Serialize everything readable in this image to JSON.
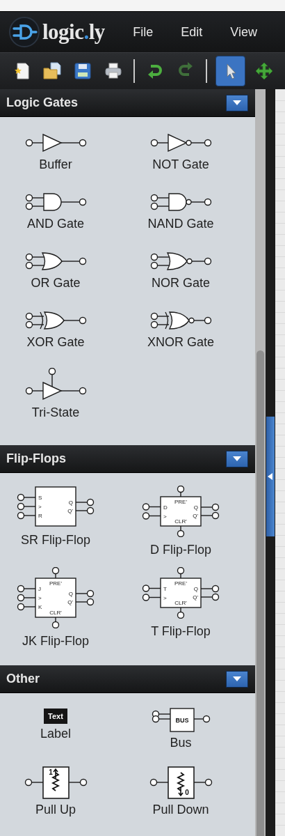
{
  "logo_parts": [
    {
      "text": "logic",
      "accent": false
    },
    {
      "text": ".",
      "accent": true
    },
    {
      "text": "ly",
      "accent": false
    }
  ],
  "menu": [
    "File",
    "Edit",
    "View"
  ],
  "toolbar": [
    {
      "kind": "new",
      "selected": false
    },
    {
      "kind": "open",
      "selected": false
    },
    {
      "kind": "save",
      "selected": false
    },
    {
      "kind": "print",
      "selected": false
    },
    {
      "kind": "separator"
    },
    {
      "kind": "undo",
      "selected": false,
      "disabled": false
    },
    {
      "kind": "redo",
      "selected": false,
      "disabled": true
    },
    {
      "kind": "separator"
    },
    {
      "kind": "select",
      "selected": true
    },
    {
      "kind": "pan",
      "selected": false
    }
  ],
  "sections": [
    {
      "title": "Logic Gates",
      "items": [
        {
          "kind": "buffer",
          "label": "Buffer"
        },
        {
          "kind": "not",
          "label": "NOT Gate"
        },
        {
          "kind": "and",
          "label": "AND Gate"
        },
        {
          "kind": "nand",
          "label": "NAND Gate"
        },
        {
          "kind": "or",
          "label": "OR Gate"
        },
        {
          "kind": "nor",
          "label": "NOR Gate"
        },
        {
          "kind": "xor",
          "label": "XOR Gate"
        },
        {
          "kind": "xnor",
          "label": "XNOR Gate"
        },
        {
          "kind": "tristate",
          "label": "Tri-State"
        }
      ]
    },
    {
      "title": "Flip-Flops",
      "items": [
        {
          "kind": "flipflop",
          "label": "SR Flip-Flop",
          "inputs": [
            "S",
            ">",
            "R"
          ],
          "outputs": [
            "Q",
            "Q'"
          ]
        },
        {
          "kind": "flipflop",
          "label": "D Flip-Flop",
          "inputs": [
            "D",
            ">"
          ],
          "outputs": [
            "Q",
            "Q'"
          ],
          "top": "PRE'",
          "bottom": "CLR'"
        },
        {
          "kind": "flipflop",
          "label": "JK Flip-Flop",
          "inputs": [
            "J",
            ">",
            "K"
          ],
          "outputs": [
            "Q",
            "Q'"
          ],
          "top": "PRE'",
          "bottom": "CLR'"
        },
        {
          "kind": "flipflop",
          "label": "T Flip-Flop",
          "inputs": [
            "T",
            ">"
          ],
          "outputs": [
            "Q",
            "Q'"
          ],
          "top": "PRE'",
          "bottom": "CLR'"
        }
      ]
    },
    {
      "title": "Other",
      "items": [
        {
          "kind": "text-label",
          "text": "Text",
          "label": "Label"
        },
        {
          "kind": "bus",
          "text": "BUS",
          "label": "Bus"
        },
        {
          "kind": "pull-up",
          "text": "1",
          "label": "Pull Up"
        },
        {
          "kind": "pull-down",
          "text": "0",
          "label": "Pull Down"
        }
      ]
    }
  ]
}
